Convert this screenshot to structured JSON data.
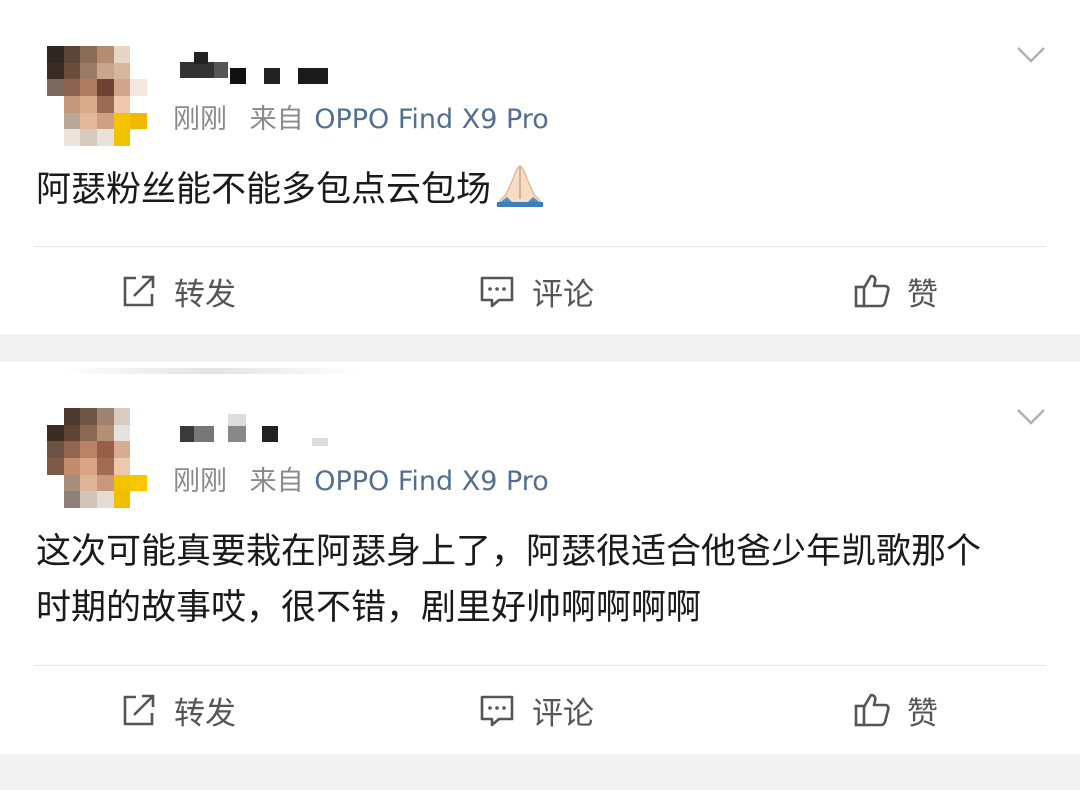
{
  "posts": [
    {
      "time": "刚刚",
      "source": "来自",
      "device": "OPPO Find X9 Pro",
      "content": "阿瑟粉丝能不能多包点云包场",
      "content_emoji": "folded-hands",
      "actions": {
        "repost": "转发",
        "comment": "评论",
        "like": "赞"
      }
    },
    {
      "time": "刚刚",
      "source": "来自",
      "device": "OPPO Find X9 Pro",
      "content": "这次可能真要栽在阿瑟身上了，阿瑟很适合他爸少年凯歌那个时期的故事哎，很不错，剧里好帅啊啊啊啊",
      "actions": {
        "repost": "转发",
        "comment": "评论",
        "like": "赞"
      }
    }
  ],
  "colors": {
    "feed_background": "#f2f2f2",
    "card_background": "#ffffff",
    "meta_gray": "#8a8a8a",
    "device_blue": "#546e8e",
    "text": "#1a1a1a"
  },
  "icons": {
    "more": "chevron-down-icon",
    "repost": "repost-icon",
    "comment": "comment-icon",
    "like": "thumbs-up-icon"
  }
}
